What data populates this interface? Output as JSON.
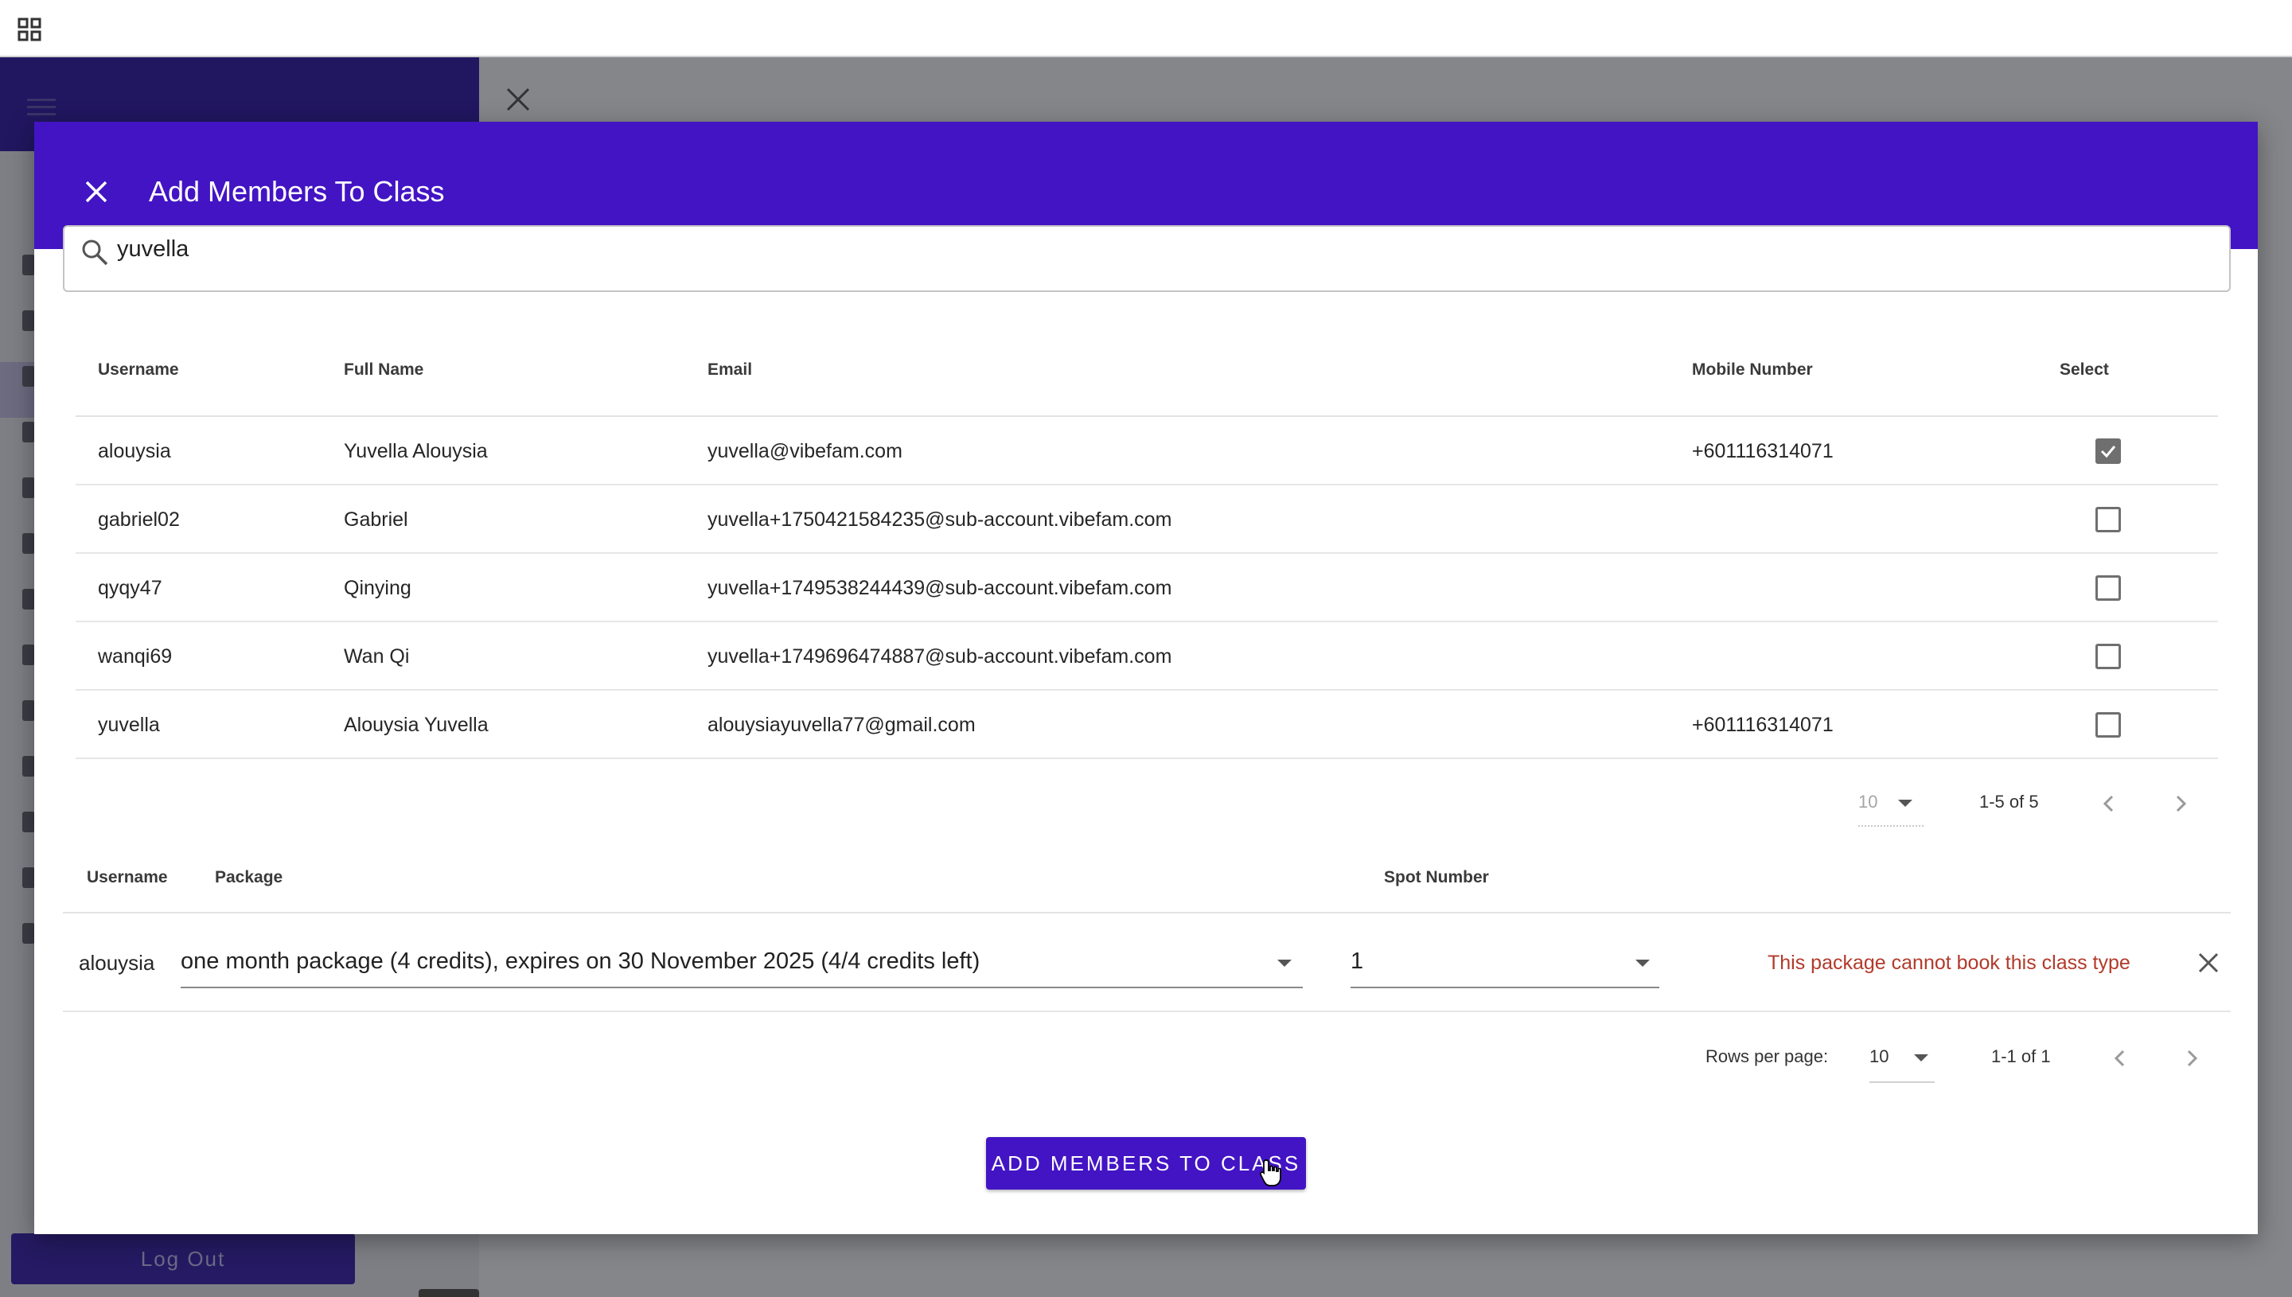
{
  "app": {
    "logout_label": "Log Out"
  },
  "icons": {
    "apps": "grid-icon",
    "menu": "hamburger-icon",
    "close": "close-icon",
    "search": "search-icon",
    "dropdown": "chevron-down-icon",
    "prev": "chevron-left-icon",
    "next": "chevron-right-icon"
  },
  "colors": {
    "accent": "#4314c4",
    "error": "#b23a2a",
    "sidebar_header": "#211660"
  },
  "dialog": {
    "title": "Add Members To Class",
    "search_value": "yuvella",
    "members_table": {
      "headers": {
        "username": "Username",
        "full_name": "Full Name",
        "email": "Email",
        "mobile": "Mobile Number",
        "select": "Select"
      },
      "rows": [
        {
          "username": "alouysia",
          "full_name": "Yuvella Alouysia",
          "email": "yuvella@vibefam.com",
          "mobile": "+601116314071",
          "selected": true
        },
        {
          "username": "gabriel02",
          "full_name": "Gabriel",
          "email": "yuvella+1750421584235@sub-account.vibefam.com",
          "mobile": "",
          "selected": false
        },
        {
          "username": "qyqy47",
          "full_name": "Qinying",
          "email": "yuvella+1749538244439@sub-account.vibefam.com",
          "mobile": "",
          "selected": false
        },
        {
          "username": "wanqi69",
          "full_name": "Wan Qi",
          "email": "yuvella+1749696474887@sub-account.vibefam.com",
          "mobile": "",
          "selected": false
        },
        {
          "username": "yuvella",
          "full_name": "Alouysia Yuvella",
          "email": "alouysiayuvella77@gmail.com",
          "mobile": "+601116314071",
          "selected": false
        }
      ],
      "pagination": {
        "rows_per_page": "10",
        "range": "1-5 of 5"
      }
    },
    "selected_table": {
      "headers": {
        "username": "Username",
        "package": "Package",
        "spot": "Spot Number"
      },
      "rows": [
        {
          "username": "alouysia",
          "package": "one month package (4 credits), expires on 30 November 2025 (4/4 credits left)",
          "spot": "1",
          "error": "This package cannot book this class type"
        }
      ],
      "pagination": {
        "rows_per_page_label": "Rows per page:",
        "rows_per_page": "10",
        "range": "1-1 of 1"
      }
    },
    "submit_label": "ADD MEMBERS TO CLASS"
  }
}
